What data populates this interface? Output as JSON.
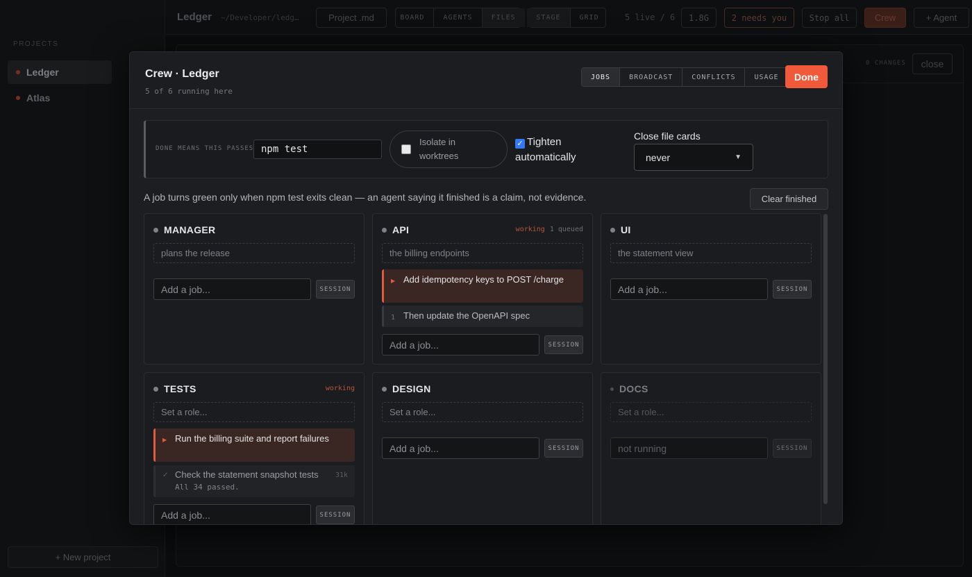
{
  "sidebar": {
    "heading": "PROJECTS",
    "projects": [
      {
        "name": "Ledger"
      },
      {
        "name": "Atlas"
      }
    ],
    "new_project": "+ New project"
  },
  "topbar": {
    "title": "Ledger",
    "path": "~/Developer/ledg…",
    "project_md": "Project .md",
    "view_tabs": [
      "BOARD",
      "AGENTS",
      "FILES"
    ],
    "mode_tabs": [
      "STAGE",
      "GRID"
    ],
    "live": "5 live / 6",
    "memory": "1.8G",
    "needs_you": "2 needs you",
    "stop_all": "Stop all",
    "crew": "Crew",
    "add_agent": "+ Agent"
  },
  "background_panel": {
    "changes": "0 CHANGES",
    "close": "close"
  },
  "modal": {
    "title": "Crew · Ledger",
    "subtitle": "5 of 6 running here",
    "tabs": [
      "JOBS",
      "BROADCAST",
      "CONFLICTS",
      "USAGE"
    ],
    "active_tab": "JOBS",
    "done": "Done",
    "settings": {
      "done_means_label": "DONE MEANS THIS PASSES",
      "done_means_value": "npm test",
      "isolate_label": "Isolate in worktrees",
      "isolate_checked": false,
      "tighten_label": "Tighten automatically",
      "tighten_checked": true,
      "close_file_cards_label": "Close file cards",
      "close_file_cards_value": "never"
    },
    "note": "A job turns green only when npm test exits clean — an agent saying it finished is a claim, not evidence.",
    "clear_finished": "Clear finished",
    "add_job_placeholder": "Add a job...",
    "session_label": "SESSION",
    "cards": [
      {
        "name": "MANAGER",
        "role": "plans the release"
      },
      {
        "name": "API",
        "status": "working",
        "queue": "1 queued",
        "role": "the billing endpoints",
        "active_job": "Add idempotency keys to POST /charge",
        "queued_job": {
          "num": "1",
          "text": "Then update the OpenAPI spec"
        }
      },
      {
        "name": "UI",
        "role": "the statement view"
      },
      {
        "name": "TESTS",
        "status": "working",
        "role": "Set a role...",
        "active_job": "Run the billing suite and report failures",
        "done_job": {
          "text": "Check the statement snapshot tests",
          "tokens": "31k",
          "result": "All 34 passed."
        }
      },
      {
        "name": "DESIGN",
        "role": "Set a role..."
      },
      {
        "name": "DOCS",
        "role": "Set a role...",
        "input": "not running"
      }
    ]
  },
  "colors": {
    "accent": "#f05a3a",
    "background": "#0b0c0d",
    "modal": "#1a1b1d"
  }
}
